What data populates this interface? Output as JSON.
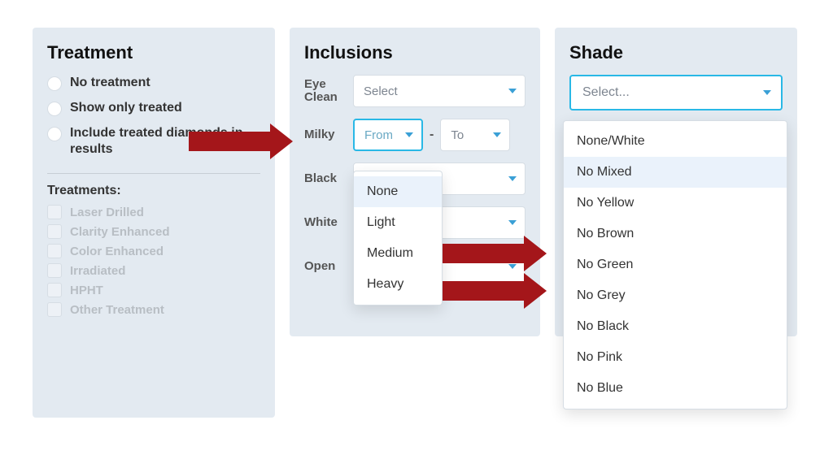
{
  "treatment": {
    "title": "Treatment",
    "radios": [
      "No treatment",
      "Show only treated",
      "Include treated diamonds in results"
    ],
    "sub_title": "Treatments:",
    "checks": [
      "Laser Drilled",
      "Clarity Enhanced",
      "Color Enhanced",
      "Irradiated",
      "HPHT",
      "Other Treatment"
    ]
  },
  "inclusions": {
    "title": "Inclusions",
    "eye_clean_label": "Eye Clean",
    "eye_clean_value": "Select",
    "milky_label": "Milky",
    "milky_from": "From",
    "milky_to": "To",
    "milky_options": [
      "None",
      "Light",
      "Medium",
      "Heavy"
    ],
    "black_label": "Black",
    "white_label": "White",
    "open_label": "Open"
  },
  "shade": {
    "title": "Shade",
    "placeholder": "Select...",
    "options": [
      "None/White",
      "No Mixed",
      "No Yellow",
      "No Brown",
      "No Green",
      "No Grey",
      "No Black",
      "No Pink",
      "No Blue"
    ],
    "highlight_index": 1
  }
}
